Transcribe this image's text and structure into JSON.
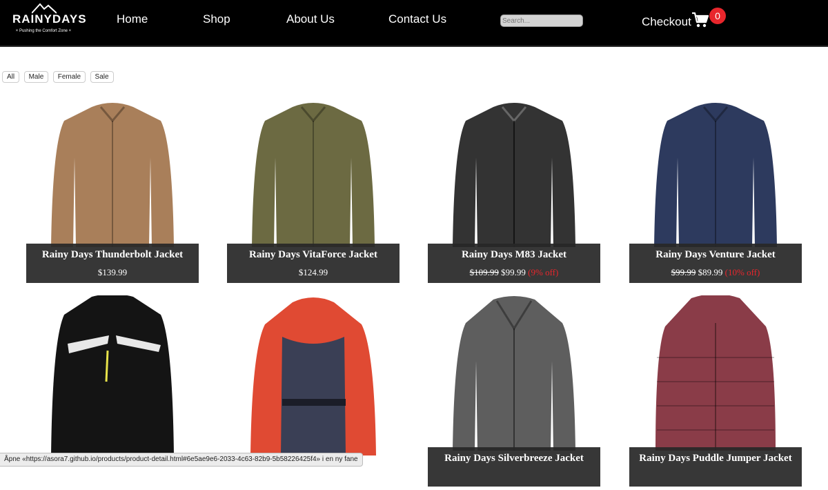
{
  "brand": {
    "name": "RAINYDAYS",
    "tagline": "× Pushing the Comfort Zone ×"
  },
  "nav": {
    "links": [
      "Home",
      "Shop",
      "About Us",
      "Contact Us"
    ]
  },
  "search": {
    "placeholder": "Search..."
  },
  "checkout": {
    "label": "Checkout",
    "cart_count": "0"
  },
  "filters": [
    "All",
    "Male",
    "Female",
    "Sale"
  ],
  "products": [
    {
      "name": "Rainy Days Thunderbolt Jacket",
      "price": "$139.99",
      "color": "#a97f5a"
    },
    {
      "name": "Rainy Days VitaForce Jacket",
      "price": "$124.99",
      "color": "#6c6a42"
    },
    {
      "name": "Rainy Days M83 Jacket",
      "old_price": "$109.99",
      "price": "$99.99",
      "discount": "(9% off)",
      "color": "#333333"
    },
    {
      "name": "Rainy Days Venture Jacket",
      "old_price": "$99.99",
      "price": "$89.99",
      "discount": "(10% off)",
      "color": "#2d3a5e"
    },
    {
      "name": "",
      "price": "",
      "color": "#141414"
    },
    {
      "name": "",
      "price": "",
      "color": "#e04a33"
    },
    {
      "name": "Rainy Days Silverbreeze Jacket",
      "price": "",
      "color": "#5e5e5e"
    },
    {
      "name": "Rainy Days Puddle Jumper Jacket",
      "price": "",
      "color": "#8a3c48"
    }
  ],
  "status_bar": {
    "text": "Åpne «https://asora7.github.io/products/product-detail.html#6e5ae9e6-2033-4c63-82b9-5b58226425f4» i en ny fane"
  },
  "colors": {
    "navbar": "#000000",
    "caption": "#282828",
    "badge": "#e8262c",
    "discount": "#e8262c"
  }
}
